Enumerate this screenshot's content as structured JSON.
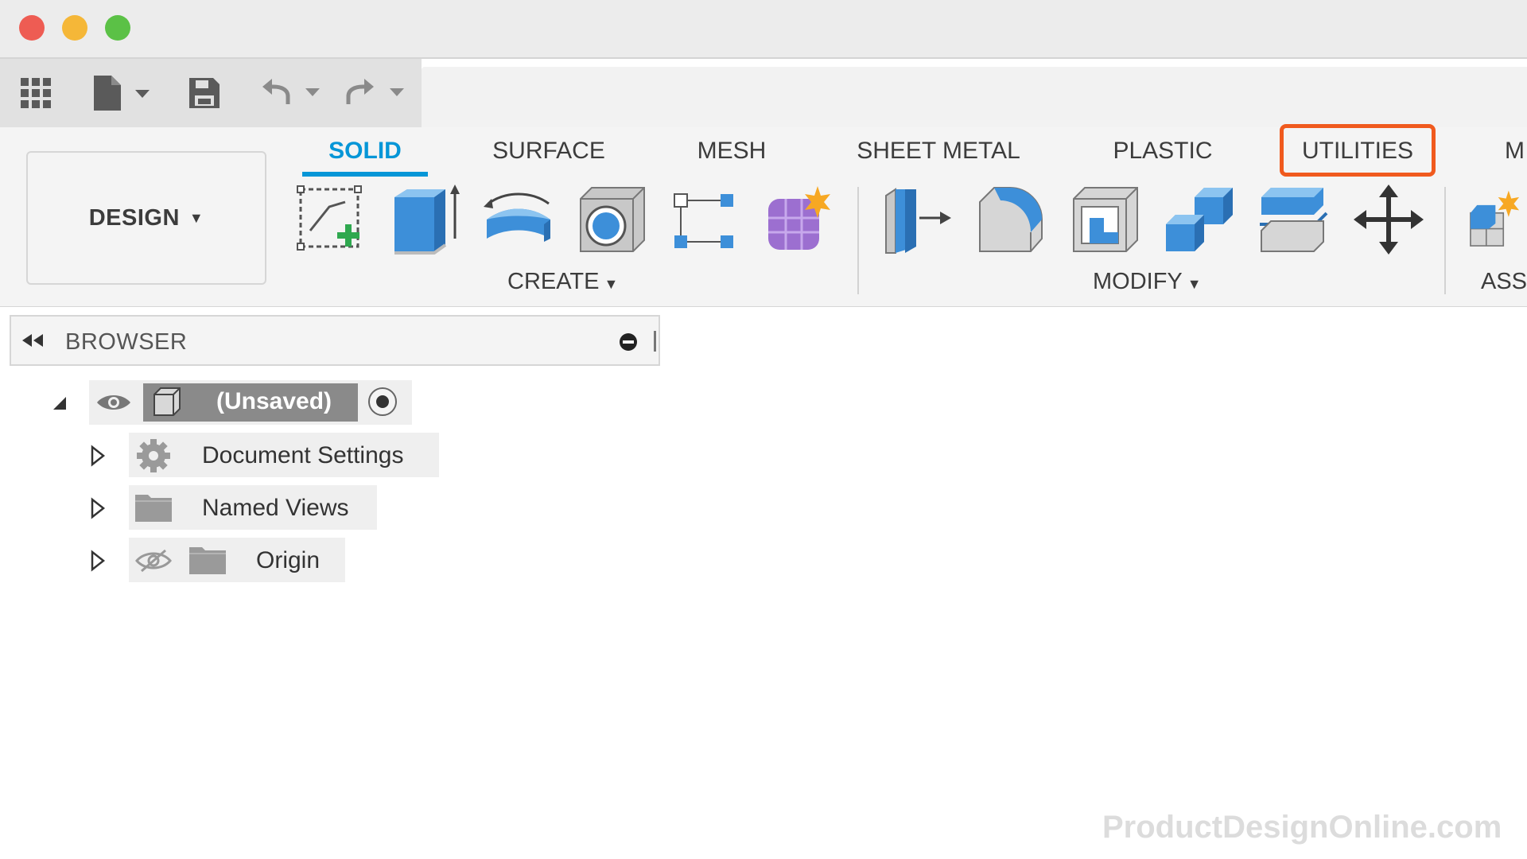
{
  "window": {
    "traffic_lights": [
      "#ee5c53",
      "#f5b738",
      "#5bc146"
    ]
  },
  "quick_access": {
    "icons": [
      "apps-grid-icon",
      "file-icon",
      "save-icon",
      "undo-icon",
      "redo-icon"
    ]
  },
  "workspace": {
    "label": "DESIGN"
  },
  "tabs": [
    {
      "label": "SOLID",
      "active": true
    },
    {
      "label": "SURFACE",
      "active": false
    },
    {
      "label": "MESH",
      "active": false
    },
    {
      "label": "SHEET METAL",
      "active": false
    },
    {
      "label": "PLASTIC",
      "active": false
    },
    {
      "label": "UTILITIES",
      "active": false,
      "highlighted": true
    },
    {
      "label": "M",
      "active": false
    }
  ],
  "groups": {
    "create": {
      "label": "CREATE",
      "tools": [
        "create-sketch-icon",
        "extrude-icon",
        "revolve-icon",
        "hole-icon",
        "pattern-icon",
        "create-form-icon"
      ]
    },
    "modify": {
      "label": "MODIFY",
      "tools": [
        "press-pull-icon",
        "fillet-icon",
        "shell-icon",
        "combine-icon",
        "offset-face-icon",
        "move-icon"
      ]
    },
    "assemble": {
      "label": "ASSI",
      "tools": [
        "new-component-icon"
      ]
    }
  },
  "browser": {
    "title": "BROWSER",
    "root": {
      "label": "(Unsaved)"
    },
    "items": [
      {
        "label": "Document Settings",
        "icon": "gear-icon"
      },
      {
        "label": "Named Views",
        "icon": "folder-icon"
      },
      {
        "label": "Origin",
        "icon": "folder-icon",
        "visibility": "hidden"
      }
    ]
  },
  "colors": {
    "accent": "#0696d7",
    "highlight": "#f05a1e"
  },
  "watermark": "ProductDesignOnline.com"
}
